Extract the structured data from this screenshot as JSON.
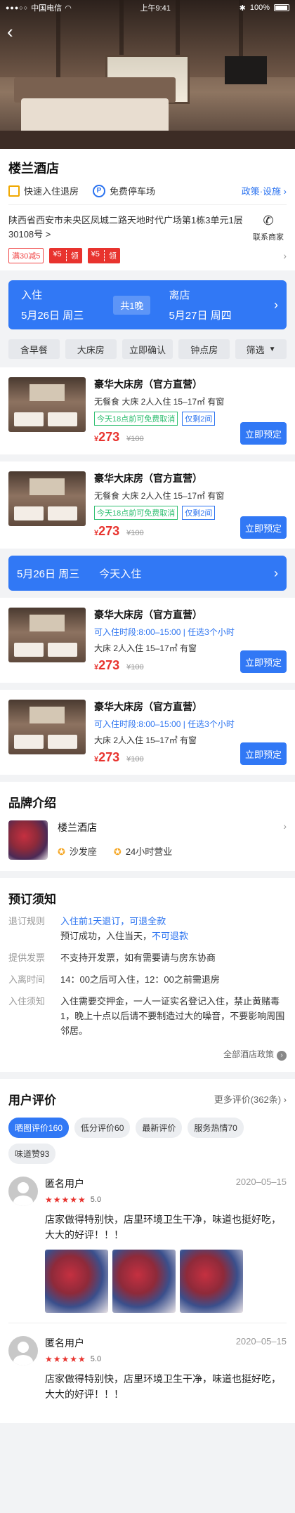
{
  "status_bar": {
    "carrier": "中国电信",
    "time": "上午9:41",
    "battery": "100%"
  },
  "hotel": {
    "name": "楼兰酒店",
    "features": [
      "快速入住退房",
      "免费停车场"
    ],
    "policy_link": "政策·设施",
    "address": "陕西省西安市未央区凤城二路天地时代广场第1栋3单元1层30108号",
    "address_arrow": ">",
    "contact_label": "联系商家",
    "coupons": {
      "plain": "满30减5",
      "red": [
        {
          "amount": "¥5",
          "action": "领"
        },
        {
          "amount": "¥5",
          "action": "领"
        }
      ]
    }
  },
  "stay": {
    "checkin_label": "入住",
    "checkin_date": "5月26日 周三",
    "nights": "共1晚",
    "checkout_label": "离店",
    "checkout_date": "5月27日 周四"
  },
  "filters": [
    "含早餐",
    "大床房",
    "立即确认",
    "钟点房",
    "筛选"
  ],
  "rooms": [
    {
      "title": "豪华大床房（官方直营）",
      "sub": "无餐食  大床  2人入住  15–17㎡  有窗",
      "tag_green": "今天18点前可免费取消",
      "tag_blue": "仅剩2间",
      "currency": "¥",
      "price": "273",
      "old": "¥100",
      "book": "立即预定"
    },
    {
      "title": "豪华大床房（官方直营）",
      "sub": "无餐食  大床  2人入住  15–17㎡  有窗",
      "tag_green": "今天18点前可免费取消",
      "tag_blue": "仅剩2间",
      "currency": "¥",
      "price": "273",
      "old": "¥100",
      "book": "立即预定"
    }
  ],
  "today": {
    "date": "5月26日 周三",
    "label": "今天入住"
  },
  "hourly_rooms": [
    {
      "title": "豪华大床房（官方直营）",
      "slot": "可入住时段:8:00–15:00  |  任选3个小时",
      "sub": "大床  2人入住  15–17㎡  有窗",
      "currency": "¥",
      "price": "273",
      "old": "¥100",
      "book": "立即预定"
    },
    {
      "title": "豪华大床房（官方直营）",
      "slot": "可入住时段:8:00–15:00  |  任选3个小时",
      "sub": "大床  2人入住  15–17㎡  有窗",
      "currency": "¥",
      "price": "273",
      "old": "¥100",
      "book": "立即预定"
    }
  ],
  "brand": {
    "title": "品牌介绍",
    "name": "楼兰酒店",
    "features": [
      "沙发座",
      "24小时营业"
    ]
  },
  "notice": {
    "title": "预订须知",
    "refund_label": "退订规则",
    "refund_line1": "入住前1天退订，可退全款",
    "refund_line2a": "预订成功，入住当天，",
    "refund_line2b": "不可退款",
    "invoice_label": "提供发票",
    "invoice": "不支持开发票，如有需要请与房东协商",
    "time_label": "入离时间",
    "time": "14：00之后可入住，12：00之前需退房",
    "rules_label": "入住须知",
    "rules": "入住需要交押金，一人一证实名登记入住，禁止黄赌毒\n1，晚上十点以后请不要制造过大的噪音，不要影响周围邻居。",
    "all_policy": "全部酒店政策"
  },
  "reviews": {
    "title": "用户评价",
    "more": "更多评价(362条)",
    "tags": [
      "晒图评价160",
      "低分评价60",
      "最新评价",
      "服务热情70",
      "味道赞93"
    ],
    "items": [
      {
        "name": "匿名用户",
        "date": "2020–05–15",
        "score": "5.0",
        "stars": "★★★★★",
        "text": "店家做得特别快，店里环境卫生干净，味道也挺好吃，大大的好评！！！"
      },
      {
        "name": "匿名用户",
        "date": "2020–05–15",
        "score": "5.0",
        "stars": "★★★★★",
        "text": "店家做得特别快，店里环境卫生干净，味道也挺好吃，大大的好评！！！"
      }
    ]
  }
}
